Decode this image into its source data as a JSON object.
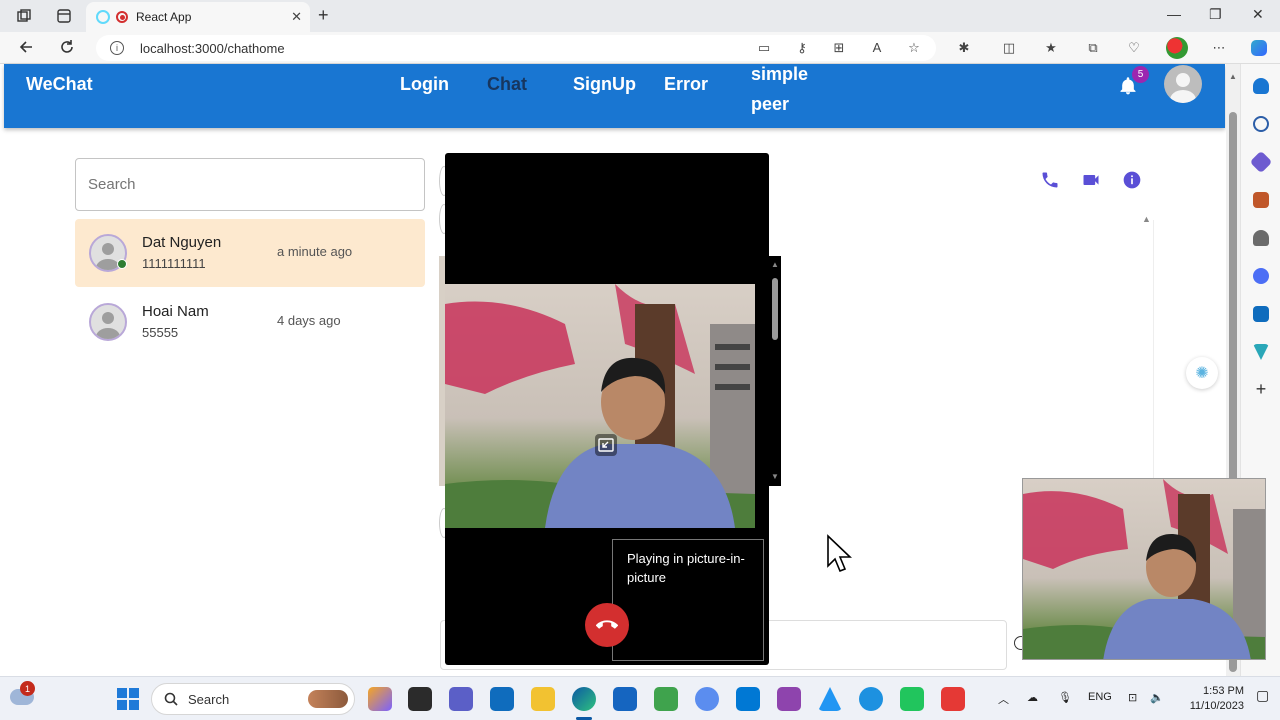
{
  "browser": {
    "tab_title": "React App",
    "url": "localhost:3000/chathome"
  },
  "app": {
    "brand": "WeChat",
    "nav": [
      {
        "label": "Login",
        "active": false
      },
      {
        "label": "Chat",
        "active": true
      },
      {
        "label": "SignUp",
        "active": false
      },
      {
        "label": "Error",
        "active": false
      },
      {
        "label": "simple peer",
        "active": false
      }
    ],
    "notifications_count": "5"
  },
  "chat": {
    "search_placeholder": "Search",
    "conversations": [
      {
        "name": "Dat Nguyen",
        "message": "1111111111",
        "time": "a minute ago",
        "selected": true,
        "online": true
      },
      {
        "name": "Hoai Nam",
        "message": "55555",
        "time": "4 days ago",
        "selected": false,
        "online": false
      }
    ]
  },
  "call": {
    "pip_note": "Playing in picture-in-picture"
  },
  "taskbar": {
    "search_placeholder": "Search",
    "weather_badge": "1",
    "language": "ENG",
    "time": "1:53 PM",
    "date": "11/10/2023"
  },
  "colors": {
    "appbar": "#1976d2",
    "accent_purple": "#6a3de8",
    "selected_convo": "#fde9cf",
    "hangup": "#d32f2f"
  }
}
